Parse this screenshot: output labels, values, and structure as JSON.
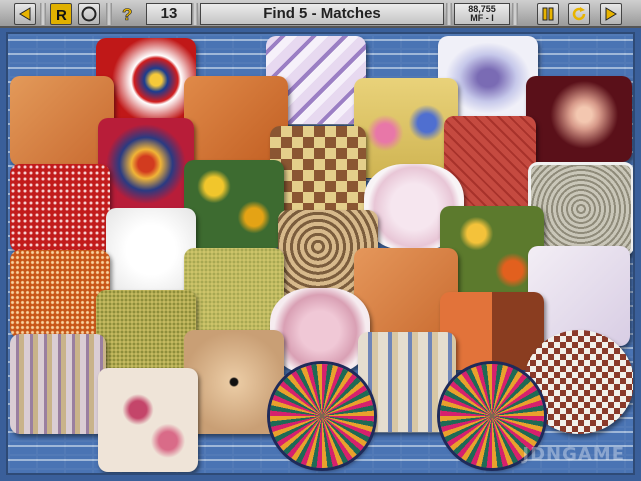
{
  "toolbar": {
    "remaining_count": "13",
    "title": "Find 5 - Matches",
    "score": "88,755",
    "level": "MF - I",
    "icons": [
      "back-arrow-icon",
      "restart-r-icon",
      "target-icon",
      "hint-question-icon",
      "pause-icon",
      "reload-icon",
      "forward-arrow-icon"
    ]
  },
  "board": {
    "watermark": "JDNGAME",
    "pillows": [
      "red-floral-pillow",
      "orange-leather-pillow",
      "lavender-swirl-pillow",
      "iris-floral-pillow",
      "burgundy-rose-pillow",
      "orange-plain-pillow",
      "hyacinth-pillow",
      "star-quilt-pillow",
      "patchwork-pillow",
      "red-quilted-pillow",
      "red-dotted-pillow",
      "yellow-floral-pillow",
      "white-ruffle-pillow",
      "gray-print-pillow",
      "white-fluffy-pillow",
      "paisley-pillow",
      "orange-floral-pillow",
      "lilac-floral-pillow",
      "orange-ditsy-pillow",
      "green-pillow",
      "orange-plain-pillow-2",
      "orange-brown-pillow",
      "olive-pillow",
      "pink-ruffle-pillow",
      "tan-button-pillow",
      "striped-pillow",
      "blue-striped-pillow",
      "checker-round-pillow",
      "rose-print-pillow",
      "star-round-pillow",
      "star-round-pillow-2"
    ]
  }
}
